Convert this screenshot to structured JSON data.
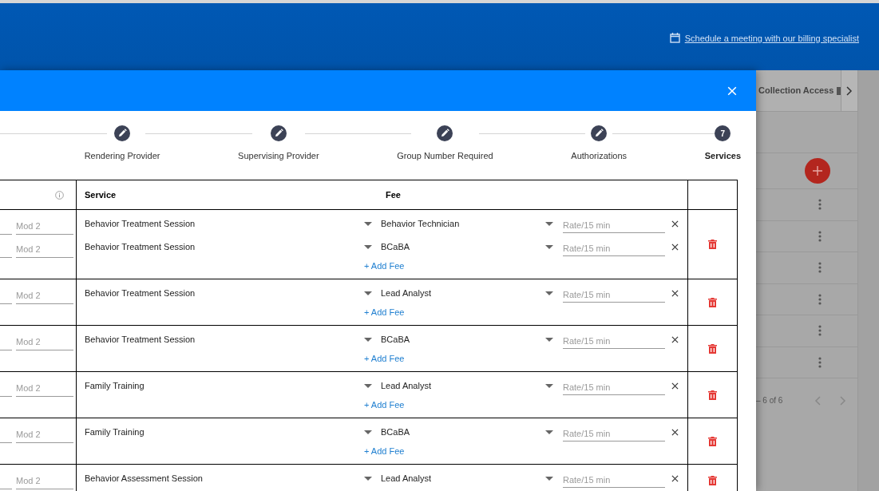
{
  "header": {
    "link": "Schedule a meeting with our billing specialist"
  },
  "dialog": {
    "steps": [
      {
        "label": "Rendering Provider",
        "kind": "edited"
      },
      {
        "label": "Supervising Provider",
        "kind": "edited"
      },
      {
        "label": "Group Number Required",
        "kind": "edited"
      },
      {
        "label": "Authorizations",
        "kind": "edited"
      },
      {
        "label": "Services",
        "kind": "current",
        "number": "7"
      }
    ],
    "table": {
      "columns": [
        "Service",
        "Fee"
      ],
      "rows": [
        {
          "lines": [
            {
              "mod2_placeholder": "Mod 2",
              "service": "Behavior Treatment Session",
              "fee": "Behavior Technician",
              "rate_placeholder": "Rate/15 min"
            },
            {
              "mod2_placeholder": "Mod 2",
              "service": "Behavior Treatment Session",
              "fee": "BCaBA",
              "rate_placeholder": "Rate/15 min"
            }
          ],
          "add_fee": "+ Add Fee"
        },
        {
          "lines": [
            {
              "mod2_placeholder": "Mod 2",
              "service": "Behavior Treatment Session",
              "fee": "Lead Analyst",
              "rate_placeholder": "Rate/15 min"
            }
          ],
          "add_fee": "+ Add Fee"
        },
        {
          "lines": [
            {
              "mod2_placeholder": "Mod 2",
              "service": "Behavior Treatment Session",
              "fee": "BCaBA",
              "rate_placeholder": "Rate/15 min"
            }
          ],
          "add_fee": "+ Add Fee"
        },
        {
          "lines": [
            {
              "mod2_placeholder": "Mod 2",
              "service": "Family Training",
              "fee": "Lead Analyst",
              "rate_placeholder": "Rate/15 min"
            }
          ],
          "add_fee": "+ Add Fee"
        },
        {
          "lines": [
            {
              "mod2_placeholder": "Mod 2",
              "service": "Family Training",
              "fee": "BCaBA",
              "rate_placeholder": "Rate/15 min"
            }
          ],
          "add_fee": "+ Add Fee"
        },
        {
          "lines": [
            {
              "mod2_placeholder": "Mod 2",
              "service": "Behavior Assessment Session",
              "fee": "Lead Analyst",
              "rate_placeholder": "Rate/15 min"
            }
          ]
        }
      ]
    }
  },
  "background": {
    "tab": "Collection Access",
    "pagination": "– 6 of 6"
  }
}
